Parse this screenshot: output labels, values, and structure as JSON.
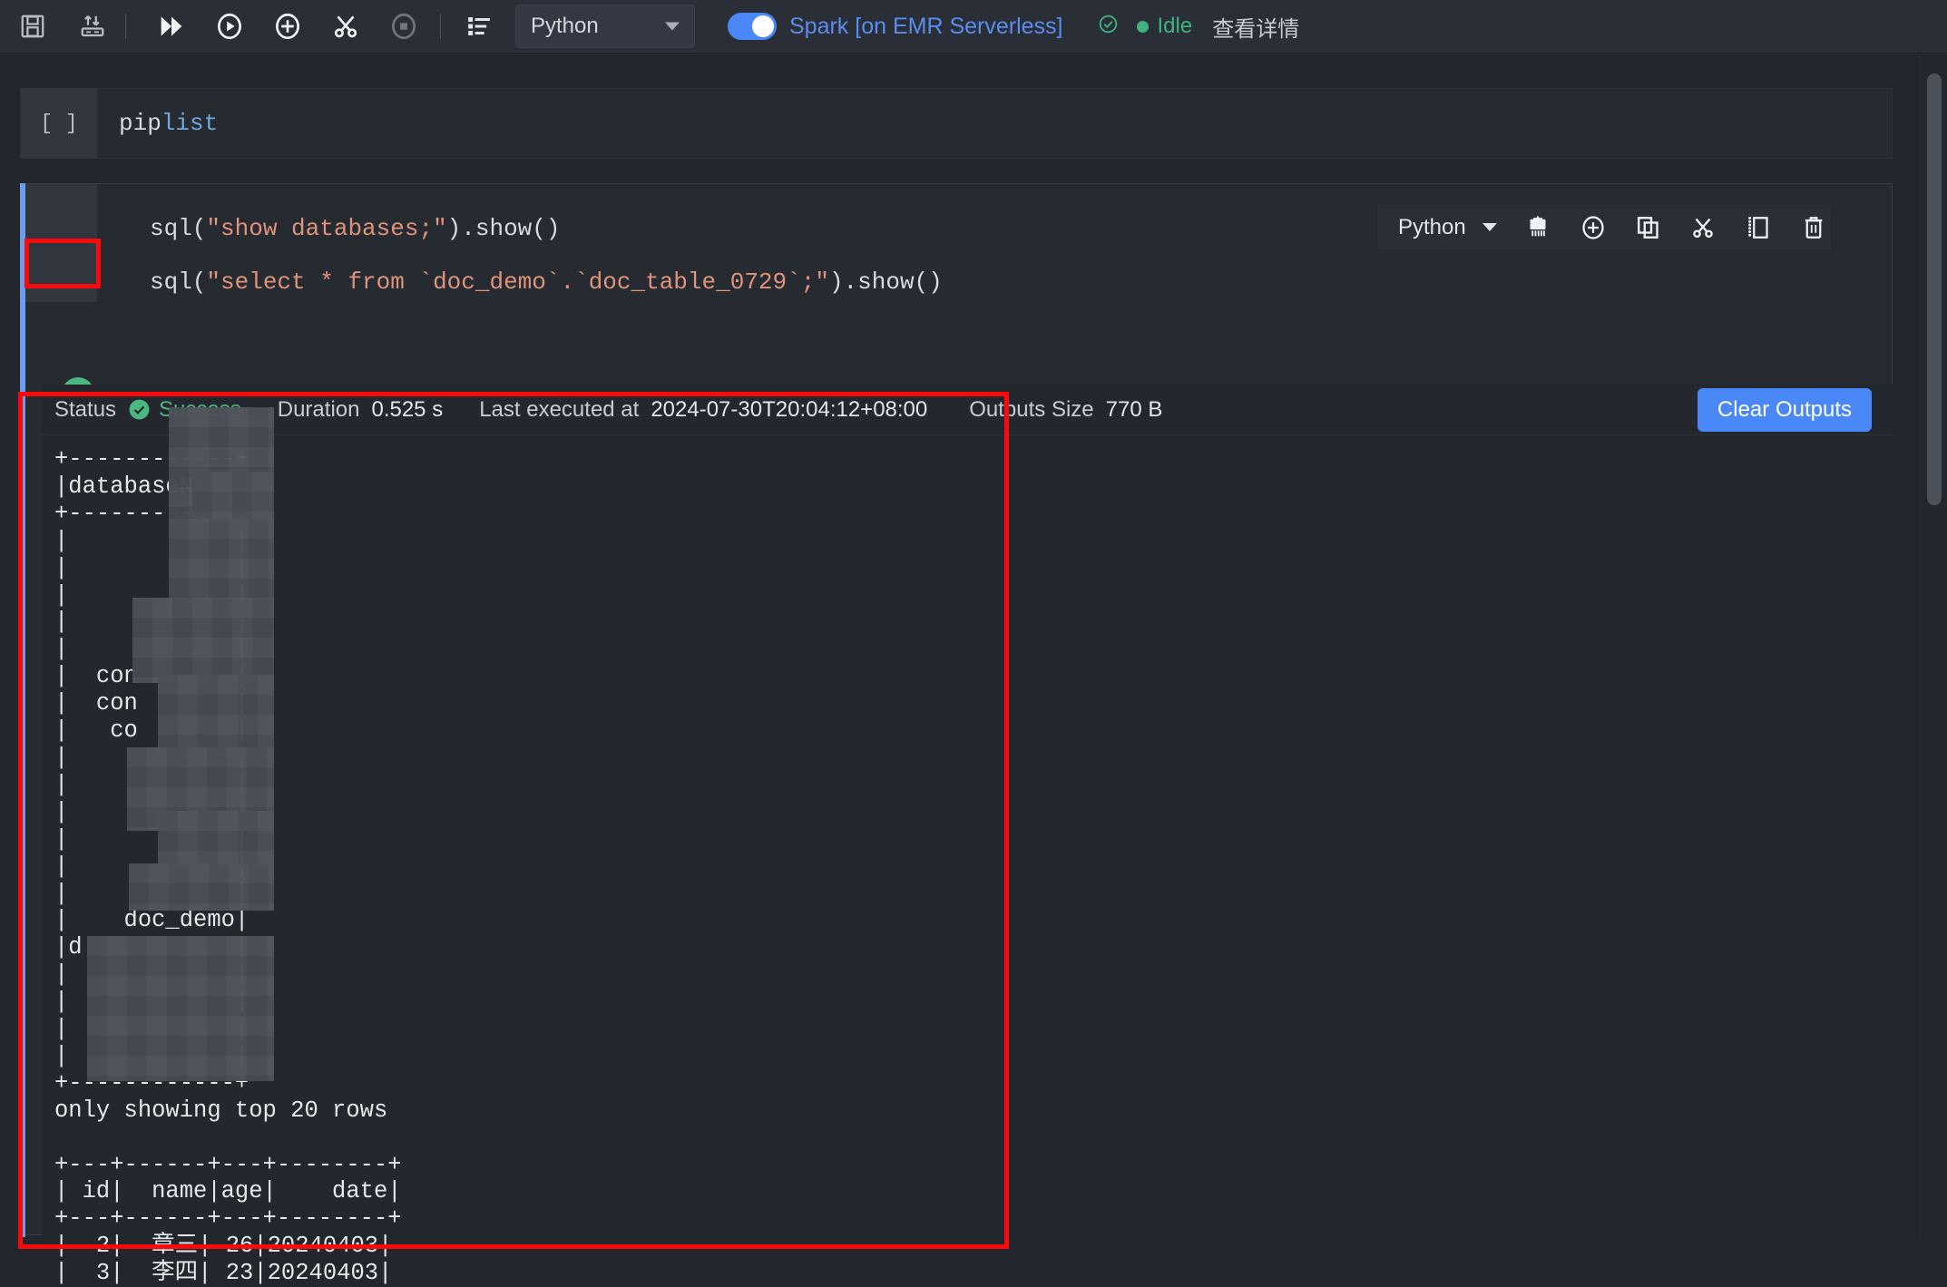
{
  "toolbar": {
    "buttons": [
      {
        "name": "save-icon",
        "title": "Save"
      },
      {
        "name": "import-export-icon",
        "title": "Import/Export"
      },
      {
        "name": "run-all-icon",
        "title": "Run all"
      },
      {
        "name": "run-cell-icon",
        "title": "Run cell"
      },
      {
        "name": "add-cell-icon",
        "title": "Add cell"
      },
      {
        "name": "cut-cell-icon",
        "title": "Cut cell"
      },
      {
        "name": "stop-icon",
        "title": "Interrupt"
      },
      {
        "name": "outline-icon",
        "title": "Table of contents"
      }
    ],
    "language": "Python",
    "spark_label": "Spark [on EMR Serverless]",
    "spark_enabled": true,
    "kernel_status": "Idle",
    "detail_link": "查看详情"
  },
  "cells": [
    {
      "prompt": "[ ]",
      "lines": [
        {
          "segments": [
            {
              "text": "pip ",
              "cls": "tok-plain"
            },
            {
              "text": "list",
              "cls": "tok-blue"
            }
          ]
        }
      ]
    },
    {
      "selected": true,
      "lines": [
        {
          "segments": [
            {
              "text": "sql(",
              "cls": "tok-plain"
            },
            {
              "text": "\"show databases;\"",
              "cls": "tok-str"
            },
            {
              "text": ").show()",
              "cls": "tok-plain"
            }
          ]
        },
        {
          "segments": [
            {
              "text": "sql(",
              "cls": "tok-plain"
            },
            {
              "text": "\"select * from `doc_demo`.`doc_table_0729`;\"",
              "cls": "tok-str"
            },
            {
              "text": ").show()",
              "cls": "tok-plain"
            }
          ]
        }
      ]
    }
  ],
  "cell_toolbar": {
    "language": "Python",
    "buttons": [
      {
        "name": "clear-outputs-icon",
        "title": "Clear outputs"
      },
      {
        "name": "add-cell-icon",
        "title": "Add cell"
      },
      {
        "name": "copy-cell-icon",
        "title": "Copy cell"
      },
      {
        "name": "cut-cell-icon",
        "title": "Cut cell"
      },
      {
        "name": "paste-cell-icon",
        "title": "Paste cell"
      },
      {
        "name": "delete-cell-icon",
        "title": "Delete cell"
      }
    ]
  },
  "output": {
    "status_label": "Status",
    "status_value": "Success",
    "duration_label": "Duration",
    "duration_value": "0.525 s",
    "last_executed_label": "Last executed at",
    "last_executed_value": "2024-07-30T20:04:12+08:00",
    "outputs_size_label": "Outputs Size",
    "outputs_size_value": "770 B",
    "clear_outputs_label": "Clear Outputs",
    "stdout": "+------------+\n|databaseName|\n+------------+\n|            |\n|            |\n|            |\n|            |\n|            |\n|  con       |\n|  con       |\n|   co       |\n|            |\n|            |\n|            |\n|            |\n|            |\n|            |\n|    doc_demo|\n|d           |\n|            |\n|            |\n|            |\n|            |\n+------------+\nonly showing top 20 rows\n\n+---+------+---+--------+\n| id|  name|age|    date|\n+---+------+---+--------+\n|  2|  章三| 26|20240403|\n|  3|  李四| 23|20240403|"
  },
  "annotations": [
    {
      "name": "run-button-highlight",
      "color": "#fa0a0a"
    },
    {
      "name": "output-region-highlight",
      "color": "#fa0a0a"
    }
  ],
  "colors": {
    "accent_blue": "#4a87f7",
    "success_green": "#4bb882",
    "annotation_red": "#fa0a0a",
    "string_token": "#e0937b",
    "background": "#23262d"
  }
}
